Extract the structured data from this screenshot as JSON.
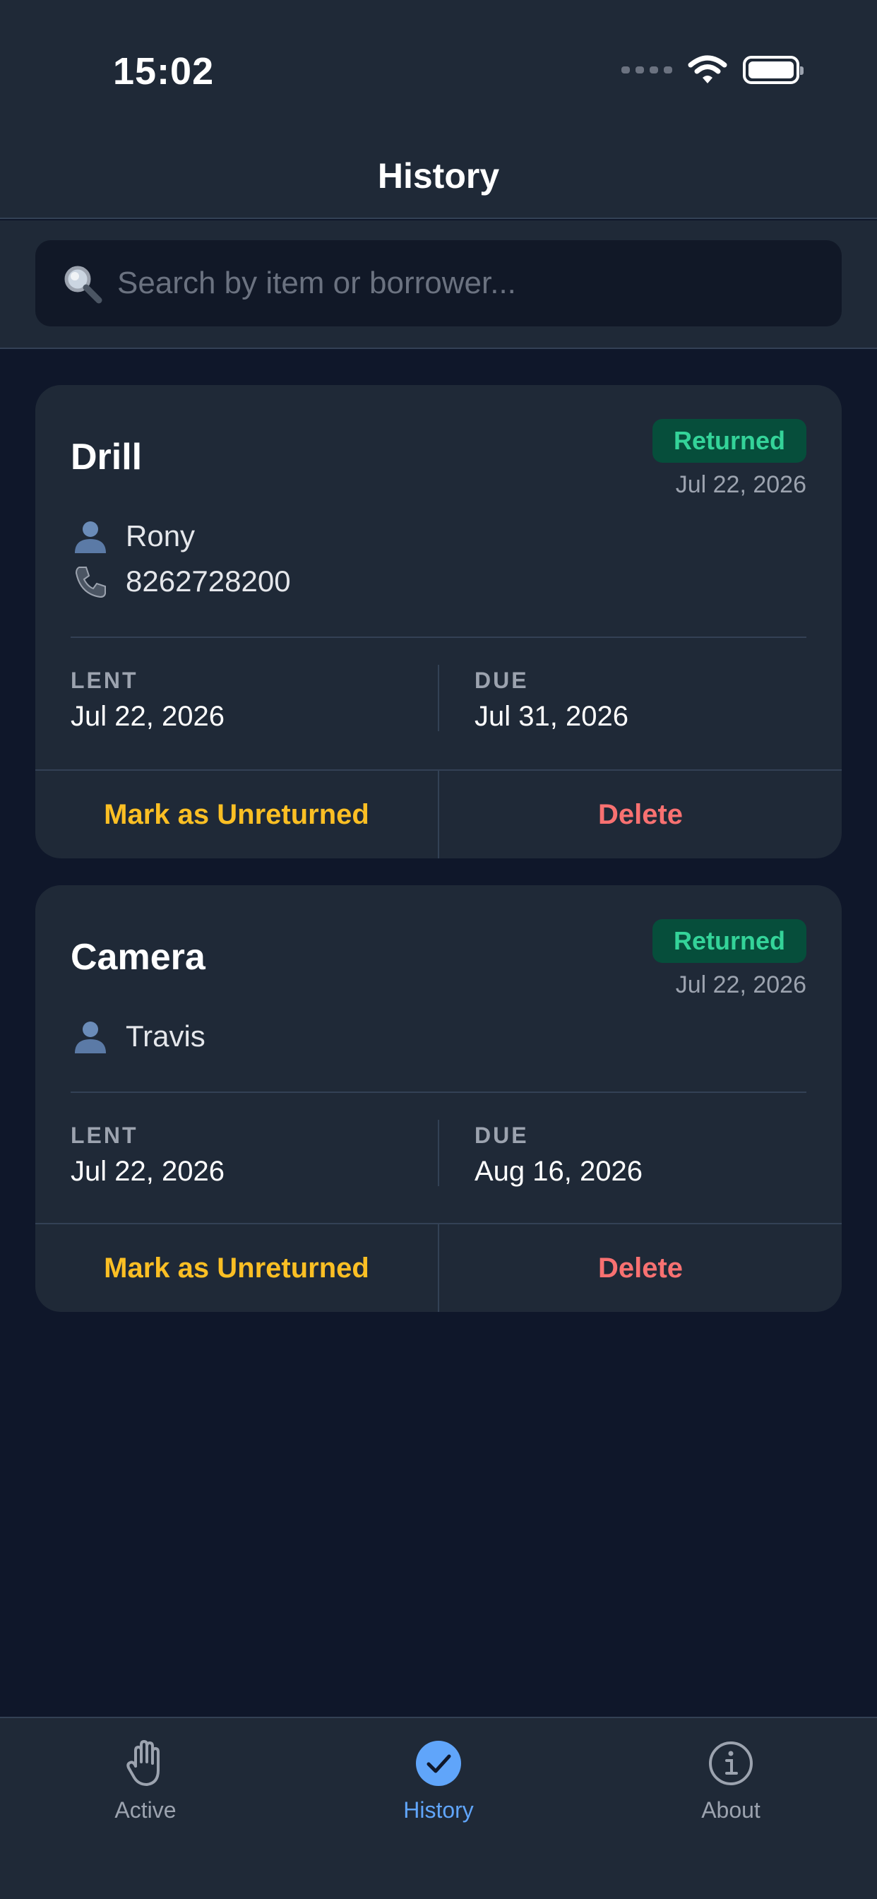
{
  "status_bar": {
    "time": "15:02"
  },
  "header": {
    "title": "History"
  },
  "search": {
    "placeholder": "Search by item or borrower..."
  },
  "loans": [
    {
      "item": "Drill",
      "status": "Returned",
      "returned_date": "Jul 22, 2026",
      "borrower": "Rony",
      "phone": "8262728200",
      "lent_label": "LENT",
      "lent_date": "Jul 22, 2026",
      "due_label": "DUE",
      "due_date": "Jul 31, 2026",
      "action_unreturn": "Mark as Unreturned",
      "action_delete": "Delete"
    },
    {
      "item": "Camera",
      "status": "Returned",
      "returned_date": "Jul 22, 2026",
      "borrower": "Travis",
      "lent_label": "LENT",
      "lent_date": "Jul 22, 2026",
      "due_label": "DUE",
      "due_date": "Aug 16, 2026",
      "action_unreturn": "Mark as Unreturned",
      "action_delete": "Delete"
    }
  ],
  "tabs": [
    {
      "label": "Active",
      "icon": "hand-icon"
    },
    {
      "label": "History",
      "icon": "checkmark-circle-icon",
      "active": true
    },
    {
      "label": "About",
      "icon": "info-icon"
    }
  ],
  "colors": {
    "background": "#0f172a",
    "card": "#1f2937",
    "accent": "#60a5fa",
    "returned_badge_text": "#34d399",
    "unreturn_action": "#fbbf24",
    "delete_action": "#f87171"
  }
}
